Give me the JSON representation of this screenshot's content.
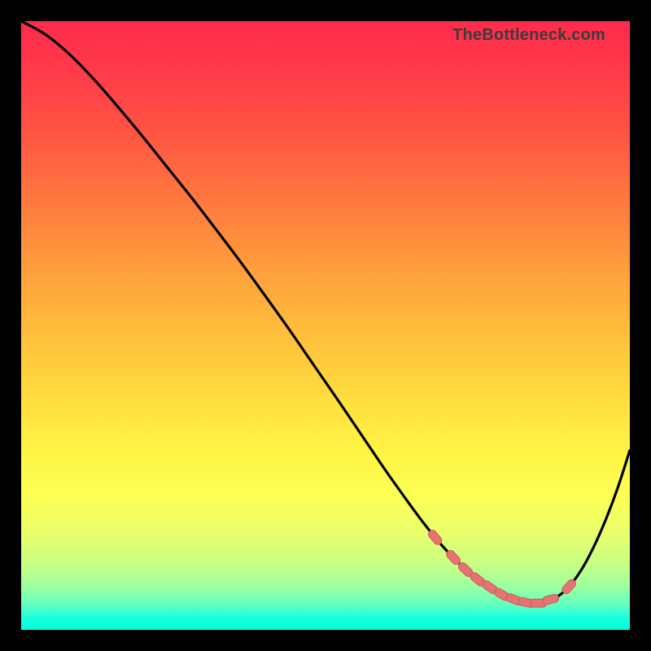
{
  "attribution": "TheBottleneck.com",
  "colors": {
    "page_bg": "#000000",
    "gradient_top": "#ff2b4c",
    "gradient_bottom": "#00ffd4",
    "curve": "#000000",
    "marker_fill": "#e57373",
    "marker_stroke": "#ce5a5a"
  },
  "chart_data": {
    "type": "line",
    "title": "",
    "xlabel": "",
    "ylabel": "",
    "xlim": [
      0,
      100
    ],
    "ylim": [
      0,
      100
    ],
    "series": [
      {
        "name": "bottleneck-curve",
        "x": [
          0,
          4,
          8,
          12,
          16,
          20,
          24,
          28,
          32,
          36,
          40,
          44,
          48,
          52,
          56,
          60,
          64,
          66,
          68,
          70,
          72,
          74,
          76,
          78,
          80,
          82,
          84,
          86,
          88,
          90,
          92,
          94,
          96,
          98,
          100
        ],
        "y": [
          100,
          97.8,
          94.5,
          90.4,
          85.8,
          81.0,
          76.0,
          71.0,
          65.8,
          60.5,
          55.0,
          49.4,
          43.6,
          37.8,
          31.9,
          26.0,
          20.4,
          17.7,
          15.2,
          12.9,
          10.9,
          9.1,
          7.6,
          6.3,
          5.3,
          4.6,
          4.4,
          4.6,
          5.4,
          7.1,
          9.8,
          13.5,
          18.0,
          23.3,
          29.5
        ]
      }
    ],
    "markers": {
      "x": [
        68,
        71,
        73,
        75,
        77,
        79,
        81,
        83,
        85,
        87,
        90
      ],
      "y": [
        15.2,
        11.9,
        9.9,
        8.3,
        7.0,
        5.8,
        5.0,
        4.5,
        4.4,
        5.0,
        7.1
      ]
    }
  }
}
